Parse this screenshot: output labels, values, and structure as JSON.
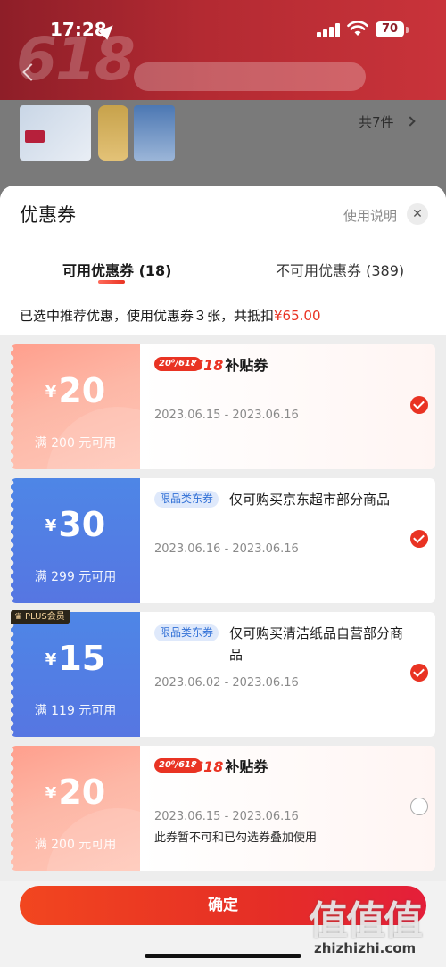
{
  "status_bar": {
    "time": "17:28",
    "battery": "70"
  },
  "background_page": {
    "banner_text": "618",
    "item_count": "共7件"
  },
  "sheet": {
    "title": "优惠券",
    "usage_link": "使用说明",
    "close_symbol": "✕",
    "tabs": [
      {
        "label": "可用优惠券 (18)",
        "active": true
      },
      {
        "label": "不可用优惠券 (389)",
        "active": false
      }
    ],
    "summary": {
      "text": "已选中推荐优惠，使用优惠券３张，共抵扣",
      "amount": "¥65.00"
    }
  },
  "coupons": [
    {
      "currency": "¥",
      "value": "20",
      "condition": "满 200 元可用",
      "badge": "20⁰/618",
      "title_num": "618",
      "title_text": "补贴券",
      "date": "2023.06.15 - 2023.06.16",
      "selected": true,
      "style": "red"
    },
    {
      "currency": "¥",
      "value": "30",
      "condition": "满 299 元可用",
      "tag": "限品类东券",
      "desc": "仅可购买京东超市部分商品",
      "date": "2023.06.16 - 2023.06.16",
      "selected": true,
      "style": "blue"
    },
    {
      "currency": "¥",
      "value": "15",
      "condition": "满 119 元可用",
      "tag": "限品类东券",
      "desc": "仅可购买清洁纸品自营部分商品",
      "date": "2023.06.02 - 2023.06.16",
      "selected": true,
      "style": "blue",
      "plus_badge": "PLUS会员"
    },
    {
      "currency": "¥",
      "value": "20",
      "condition": "满 200 元可用",
      "badge": "20⁰/618",
      "title_num": "618",
      "title_text": "补贴券",
      "date": "2023.06.15 - 2023.06.16",
      "note": "此券暂不可和已勾选券叠加使用",
      "selected": false,
      "style": "red"
    }
  ],
  "confirm_label": "确定",
  "watermark": {
    "glyphs": "值值值",
    "text": "zhizhizhi.com"
  },
  "colors": {
    "accent": "#e93323",
    "blue_coupon": "#4e86e6",
    "red_coupon": "#ffb3a3"
  },
  "icons": [
    "location-arrow-icon",
    "signal-icon",
    "wifi-icon",
    "battery-icon",
    "back-icon",
    "chevron-right-icon",
    "close-icon",
    "check-icon",
    "crown-icon"
  ]
}
